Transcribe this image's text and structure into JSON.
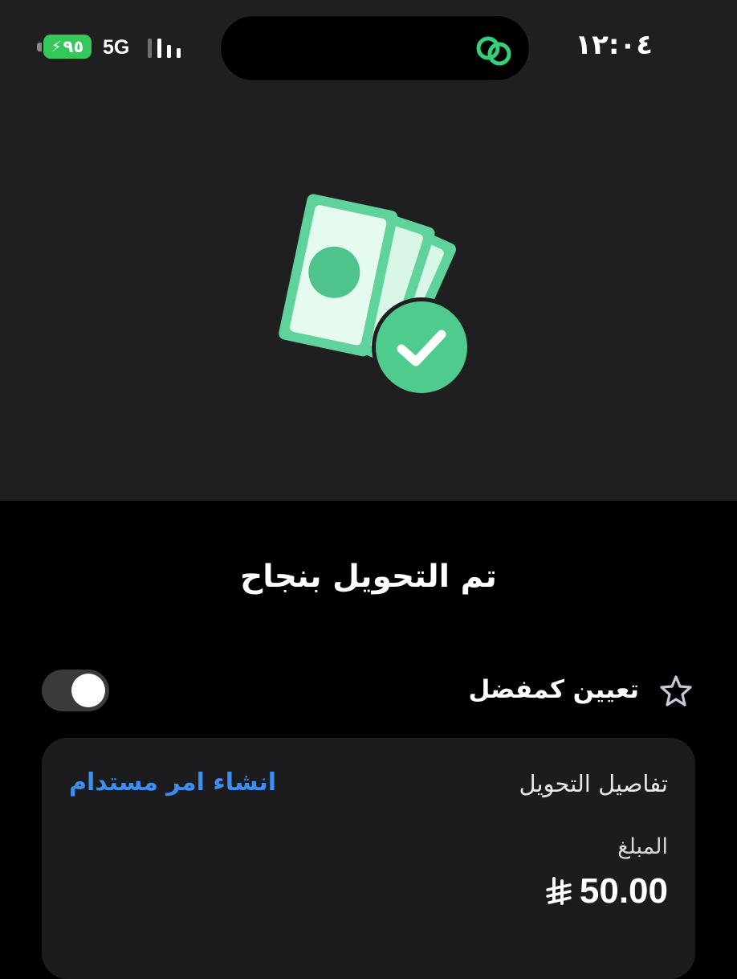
{
  "status_bar": {
    "time": "١٢:٠٤",
    "network": "5G",
    "battery": "٩٥",
    "icons": [
      "signal-bars-icon",
      "battery-charging-icon",
      "link-app-icon"
    ]
  },
  "illustration": {
    "icon": "money-transfer-success-icon",
    "colors": {
      "bill": "#5fd39b",
      "bill_light": "#d8f7e6",
      "check_circle": "#4fcb8e"
    }
  },
  "title": "تم التحويل بنجاح",
  "favorite": {
    "label": "تعيين كمفضل",
    "toggle_on": false,
    "icon": "star-icon"
  },
  "details": {
    "heading": "تفاصيل التحويل",
    "action_link": "انشاء امر مستدام",
    "amount_label": "المبلغ",
    "amount_value": "50.00",
    "currency_icon": "saudi-riyal-icon"
  },
  "colors": {
    "background": "#000000",
    "hero_background": "#1f1f21",
    "card": "#1c1c1e",
    "link": "#3d8ef0",
    "battery": "#34c759"
  }
}
